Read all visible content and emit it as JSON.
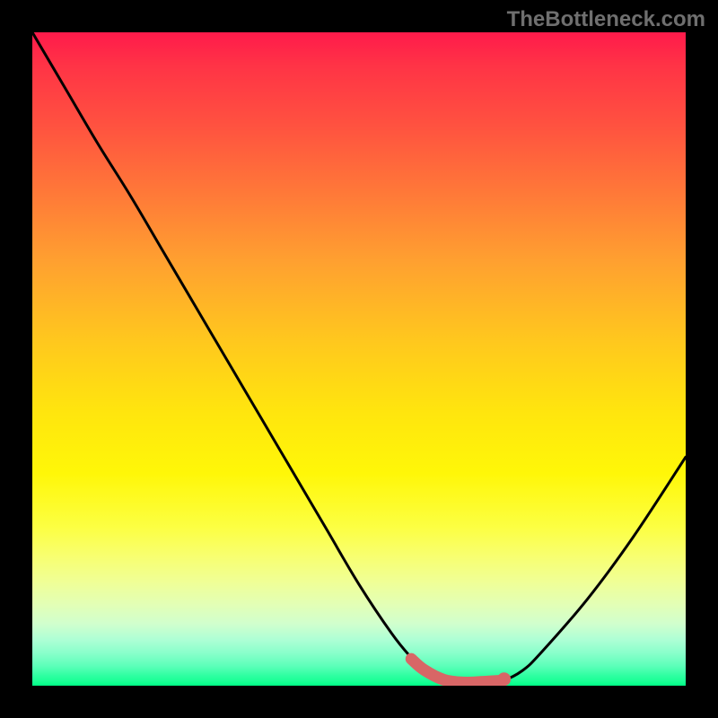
{
  "watermark": "TheBottleneck.com",
  "colors": {
    "frame": "#000000",
    "curve": "#000000",
    "highlight": "#d86666",
    "dotFill": "#d86666",
    "gradientTop": "#ff1a4b",
    "gradientBottom": "#00ff87"
  },
  "chart_data": {
    "type": "line",
    "title": "",
    "xlabel": "",
    "ylabel": "",
    "xlim": [
      0,
      100
    ],
    "ylim": [
      0,
      100
    ],
    "grid": false,
    "legend": "none",
    "series": [
      {
        "name": "curve",
        "x": [
          0,
          5,
          10,
          15,
          20,
          25,
          30,
          35,
          40,
          45,
          50,
          55,
          58,
          60,
          63,
          66,
          69,
          72,
          75,
          78,
          85,
          92,
          100
        ],
        "values": [
          100,
          91.5,
          83,
          75,
          66.5,
          58,
          49.5,
          41,
          32.5,
          24,
          15.5,
          8,
          4.3,
          2.4,
          0.9,
          0.5,
          0.6,
          0.8,
          2.3,
          5.2,
          13.3,
          22.8,
          35
        ]
      }
    ],
    "highlight_segment": {
      "x": [
        58,
        60,
        63,
        66,
        69,
        71.5
      ],
      "values": [
        4.1,
        2.4,
        0.9,
        0.5,
        0.6,
        0.75
      ]
    },
    "dot": {
      "x": 72.2,
      "y": 1.0
    }
  }
}
